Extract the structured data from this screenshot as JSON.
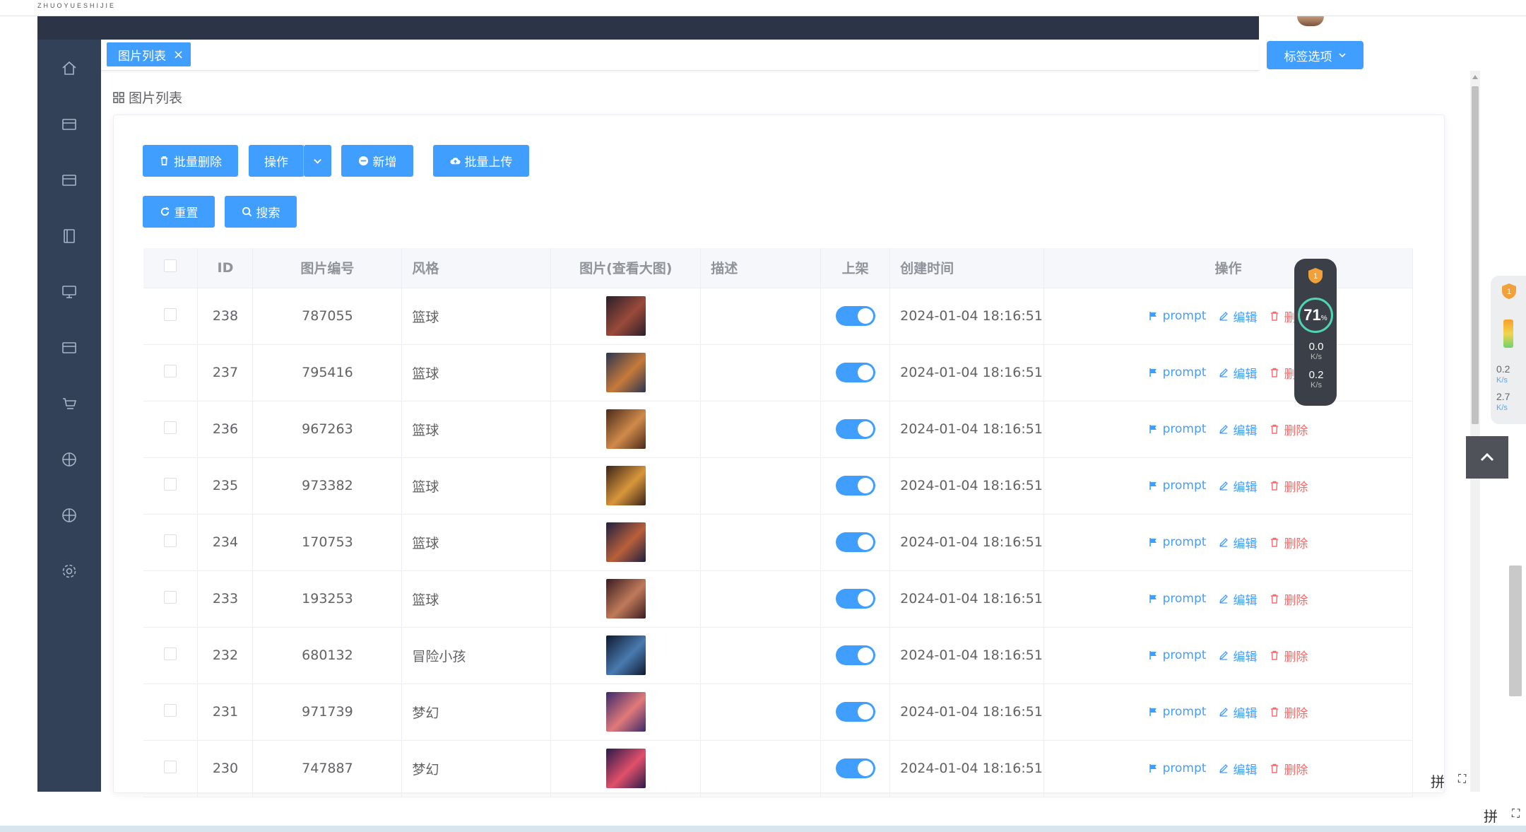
{
  "app": {
    "brand": "ZHUOYUESHIJIE"
  },
  "tabs": [
    {
      "label": "图片列表",
      "close": "×"
    }
  ],
  "tag_options": {
    "label": "标签选项"
  },
  "breadcrumb": {
    "label": "图片列表"
  },
  "toolbar": {
    "batch_delete": "批量删除",
    "action": "操作",
    "add": "新增",
    "batch_upload": "批量上传",
    "reset": "重置",
    "search": "搜索"
  },
  "table": {
    "headers": {
      "id": "ID",
      "code": "图片编号",
      "style": "风格",
      "image": "图片(查看大图)",
      "desc": "描述",
      "listed": "上架",
      "created": "创建时间",
      "ops": "操作"
    },
    "op_labels": {
      "prompt": "prompt",
      "edit": "编辑",
      "delete": "删除"
    },
    "rows": [
      {
        "id": "238",
        "code": "787055",
        "style": "篮球",
        "desc": "",
        "listed": true,
        "created": "2024-01-04 18:16:51",
        "thumb_colors": [
          "#2a1f2a",
          "#9a4a3a"
        ]
      },
      {
        "id": "237",
        "code": "795416",
        "style": "篮球",
        "desc": "",
        "listed": true,
        "created": "2024-01-04 18:16:51",
        "thumb_colors": [
          "#2a3550",
          "#c67a3a"
        ]
      },
      {
        "id": "236",
        "code": "967263",
        "style": "篮球",
        "desc": "",
        "listed": true,
        "created": "2024-01-04 18:16:51",
        "thumb_colors": [
          "#4a2a1a",
          "#d08a4a"
        ]
      },
      {
        "id": "235",
        "code": "973382",
        "style": "篮球",
        "desc": "",
        "listed": true,
        "created": "2024-01-04 18:16:51",
        "thumb_colors": [
          "#3a2418",
          "#d8963a"
        ]
      },
      {
        "id": "234",
        "code": "170753",
        "style": "篮球",
        "desc": "",
        "listed": true,
        "created": "2024-01-04 18:16:51",
        "thumb_colors": [
          "#1e2040",
          "#b8603a"
        ]
      },
      {
        "id": "233",
        "code": "193253",
        "style": "篮球",
        "desc": "",
        "listed": true,
        "created": "2024-01-04 18:16:51",
        "thumb_colors": [
          "#3a1c20",
          "#c07a5a"
        ]
      },
      {
        "id": "232",
        "code": "680132",
        "style": "冒险小孩",
        "desc": "",
        "listed": true,
        "created": "2024-01-04 18:16:51",
        "thumb_colors": [
          "#0e1a30",
          "#4a7ab0"
        ]
      },
      {
        "id": "231",
        "code": "971739",
        "style": "梦幻",
        "desc": "",
        "listed": true,
        "created": "2024-01-04 18:16:51",
        "thumb_colors": [
          "#3a2a6a",
          "#e07a7a"
        ]
      },
      {
        "id": "230",
        "code": "747887",
        "style": "梦幻",
        "desc": "",
        "listed": true,
        "created": "2024-01-04 18:16:51",
        "thumb_colors": [
          "#2a1a4a",
          "#e0506a"
        ]
      }
    ]
  },
  "net_meter": {
    "percent": "71",
    "percent_unit": "%",
    "up": "0.0",
    "down": "0.2",
    "unit": "K/s",
    "badge": "1"
  },
  "side_panel": {
    "up": "0.2",
    "down": "2.7",
    "unit": "K/s",
    "badge": "1"
  },
  "ime": {
    "label": "拼"
  },
  "colors": {
    "primary": "#409eff",
    "danger": "#f56c6c",
    "sidebar": "#324157",
    "header": "#2c3548"
  },
  "sidebar_icons": [
    "home-icon",
    "card-icon",
    "card-icon",
    "book-icon",
    "monitor-icon",
    "card-icon",
    "cart-icon",
    "target-icon",
    "target-icon",
    "gear-icon"
  ]
}
